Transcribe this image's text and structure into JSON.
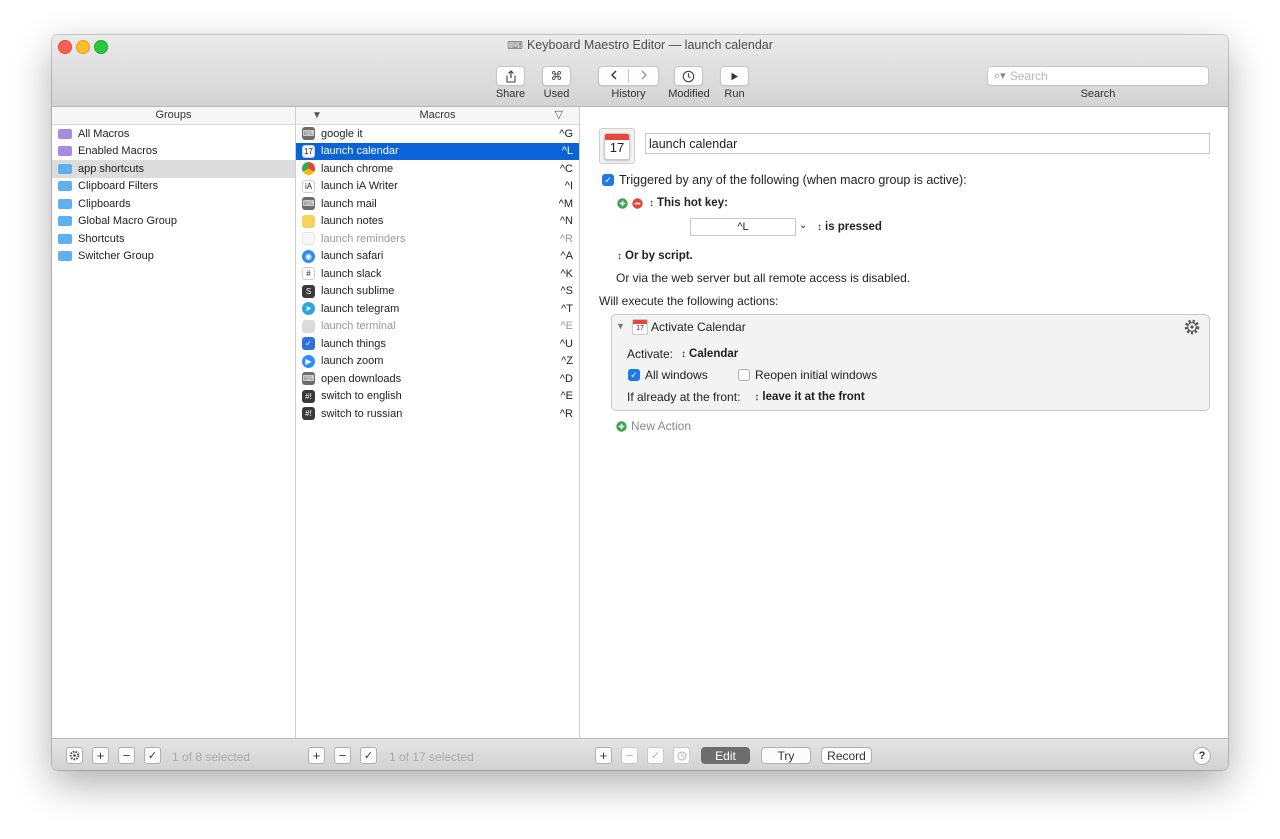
{
  "window": {
    "title": "Keyboard Maestro Editor — launch calendar"
  },
  "toolbar": {
    "share_label": "Share",
    "used_label": "Used",
    "used_glyph": "⌘",
    "history_label": "History",
    "modified_label": "Modified",
    "run_label": "Run",
    "search_placeholder": "Search",
    "search_label": "Search"
  },
  "groups": {
    "header": "Groups",
    "items": [
      {
        "label": "All Macros",
        "smart": true
      },
      {
        "label": "Enabled Macros",
        "smart": true
      },
      {
        "label": "app shortcuts",
        "smart": false
      },
      {
        "label": "Clipboard Filters",
        "smart": false
      },
      {
        "label": "Clipboards",
        "smart": false
      },
      {
        "label": "Global Macro Group",
        "smart": false
      },
      {
        "label": "Shortcuts",
        "smart": false
      },
      {
        "label": "Switcher Group",
        "smart": false
      }
    ],
    "status": "1 of 8 selected"
  },
  "macros": {
    "header": "Macros",
    "items": [
      {
        "label": "google it",
        "hotkey": "^G",
        "icon": "keystroke-icon",
        "color": "#6d6d6d",
        "glyph": "⌨"
      },
      {
        "label": "launch calendar",
        "hotkey": "^L",
        "icon": "calendar-icon",
        "color": "#ffffff",
        "glyph": "17"
      },
      {
        "label": "launch chrome",
        "hotkey": "^C",
        "icon": "chrome-icon",
        "color": "#ea4335",
        "glyph": ""
      },
      {
        "label": "launch iA Writer",
        "hotkey": "^I",
        "icon": "ia-writer-icon",
        "color": "#ffffff",
        "glyph": "iA"
      },
      {
        "label": "launch mail",
        "hotkey": "^M",
        "icon": "keystroke-icon",
        "color": "#6d6d6d",
        "glyph": "⌨"
      },
      {
        "label": "launch notes",
        "hotkey": "^N",
        "icon": "notes-icon",
        "color": "#f4d35e",
        "glyph": ""
      },
      {
        "label": "launch reminders",
        "hotkey": "^R",
        "icon": "reminders-icon",
        "color": "#f0f0f0",
        "glyph": "",
        "disabled": true
      },
      {
        "label": "launch safari",
        "hotkey": "^A",
        "icon": "safari-icon",
        "color": "#2b8cf0",
        "glyph": "◉"
      },
      {
        "label": "launch slack",
        "hotkey": "^K",
        "icon": "slack-icon",
        "color": "#ffffff",
        "glyph": "#"
      },
      {
        "label": "launch sublime",
        "hotkey": "^S",
        "icon": "sublime-icon",
        "color": "#3b3b3b",
        "glyph": "S"
      },
      {
        "label": "launch telegram",
        "hotkey": "^T",
        "icon": "telegram-icon",
        "color": "#2ea6df",
        "glyph": "➤"
      },
      {
        "label": "launch terminal",
        "hotkey": "^E",
        "icon": "terminal-icon",
        "color": "#bdbdbd",
        "glyph": "",
        "disabled": true
      },
      {
        "label": "launch things",
        "hotkey": "^U",
        "icon": "things-icon",
        "color": "#2f73d8",
        "glyph": "✓"
      },
      {
        "label": "launch zoom",
        "hotkey": "^Z",
        "icon": "zoom-icon",
        "color": "#2d8cff",
        "glyph": "▶"
      },
      {
        "label": "open downloads",
        "hotkey": "^D",
        "icon": "keystroke-icon",
        "color": "#6d6d6d",
        "glyph": "⌨"
      },
      {
        "label": "switch to english",
        "hotkey": "^E",
        "icon": "script-icon",
        "color": "#3a3a3a",
        "glyph": "#!"
      },
      {
        "label": "switch to russian",
        "hotkey": "^R",
        "icon": "script-icon",
        "color": "#3a3a3a",
        "glyph": "#!"
      }
    ],
    "status": "1 of 17 selected"
  },
  "editor": {
    "macro_name": "launch calendar",
    "calendar_day": "17",
    "trigger_label": "Triggered by any of the following (when macro group is active):",
    "hotkey_title": "This hot key:",
    "hotkey_value": "^L",
    "hotkey_state": "is pressed",
    "script_label": "Or by script.",
    "web_server_text": "Or via the web server but all remote access is disabled.",
    "actions_label": "Will execute the following actions:",
    "action": {
      "title": "Activate Calendar",
      "activate_label": "Activate:",
      "activate_value": "Calendar",
      "all_windows_label": "All windows",
      "all_windows_checked": true,
      "reopen_label": "Reopen initial windows",
      "reopen_checked": false,
      "front_label": "If already at the front:",
      "front_value": "leave it at the front"
    },
    "new_action_label": "New Action"
  },
  "bottom": {
    "edit_label": "Edit",
    "try_label": "Try",
    "record_label": "Record",
    "help_label": "?"
  },
  "colors": {
    "selection_blue": "#0b63d8",
    "checkbox_blue": "#1e78e6",
    "add_green": "#3aa34a",
    "remove_red": "#e2453f"
  }
}
